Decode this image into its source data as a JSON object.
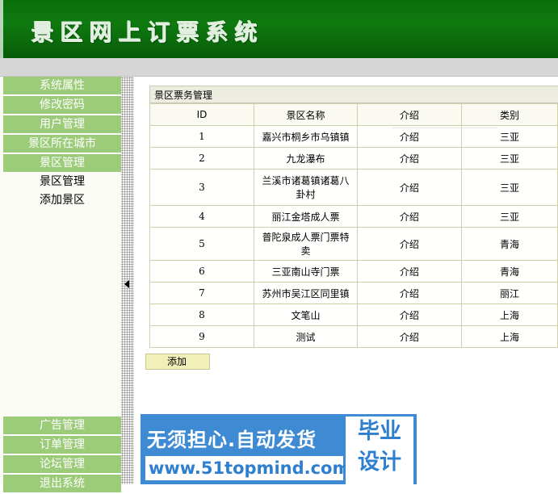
{
  "header": {
    "title": "景区网上订票系统",
    "colors": {
      "header_green": "#0f7a10",
      "menu_green": "#9ccc7a"
    }
  },
  "sidebar": {
    "top_items": [
      "系统属性",
      "修改密码",
      "用户管理",
      "景区所在城市",
      "景区管理"
    ],
    "sub_items": [
      "景区管理",
      "添加景区"
    ],
    "bottom_items": [
      "广告管理",
      "订单管理",
      "论坛管理",
      "退出系统"
    ],
    "collapse_icon": "chevron-left-icon"
  },
  "panel": {
    "title": "景区票务管理",
    "columns": [
      "ID",
      "景区名称",
      "介绍",
      "类别"
    ],
    "rows": [
      {
        "id": "1",
        "name": "嘉兴市桐乡市乌镇镇",
        "intro": "介绍",
        "category": "三亚"
      },
      {
        "id": "2",
        "name": "九龙瀑布",
        "intro": "介绍",
        "category": "三亚"
      },
      {
        "id": "3",
        "name": "兰溪市诸葛镇诸葛八卦村",
        "intro": "介绍",
        "category": "三亚"
      },
      {
        "id": "4",
        "name": "丽江金塔成人票",
        "intro": "介绍",
        "category": "三亚"
      },
      {
        "id": "5",
        "name": "普陀泉成人票门票特卖",
        "intro": "介绍",
        "category": "青海"
      },
      {
        "id": "6",
        "name": "三亚南山寺门票",
        "intro": "介绍",
        "category": "青海"
      },
      {
        "id": "7",
        "name": "苏州市吴江区同里镇",
        "intro": "介绍",
        "category": "丽江"
      },
      {
        "id": "8",
        "name": "文笔山",
        "intro": "介绍",
        "category": "上海"
      },
      {
        "id": "9",
        "name": "测试",
        "intro": "介绍",
        "category": "上海"
      }
    ],
    "add_label": "添加"
  },
  "banner": {
    "line1": "无须担心.自动发货",
    "line2": "www.51topmind.com",
    "badge_line1": "毕业",
    "badge_line2": "设计"
  }
}
